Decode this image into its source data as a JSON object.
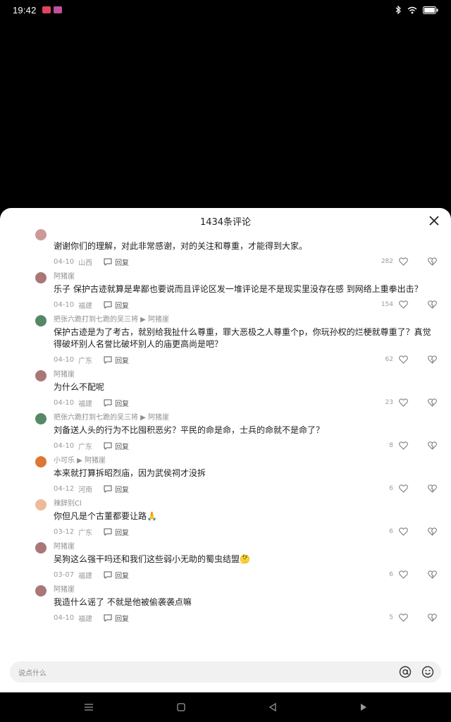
{
  "status": {
    "time": "19:42",
    "notif_colors": [
      "#e0445e",
      "#c0519a"
    ]
  },
  "sheet": {
    "title": "1434条评论"
  },
  "comments": [
    {
      "name": "",
      "text": "谢谢你们的理解，对此非常感谢，对的关注和尊重，才能得到大家。",
      "date": "04-10",
      "region": "山西",
      "reply_label": "回复",
      "likes": "282",
      "avatar": "#c99"
    },
    {
      "name": "阿猪崖",
      "text": "乐子 保护古迹就算是卑鄙也要说而且评论区发一堆评论是不是现实里没存在感 到网络上重拳出击？",
      "date": "04-10",
      "region": "福建",
      "reply_label": "回复",
      "likes": "154",
      "avatar": "#a77"
    },
    {
      "name": "把张六跪打到七跪的吴三将 ▶ 阿猪崖",
      "text": "保护古迹是为了考古，就别给我扯什么尊重，罪大恶极之人尊重个p，你玩孙权的烂梗就尊重了？真觉得破坏别人名誉比破坏别人的庙更高尚是吧？",
      "date": "04-10",
      "region": "广东",
      "reply_label": "回复",
      "likes": "62",
      "avatar": "#586"
    },
    {
      "name": "阿猪崖",
      "text": "为什么不配呢",
      "date": "04-10",
      "region": "福建",
      "reply_label": "回复",
      "likes": "23",
      "avatar": "#a77"
    },
    {
      "name": "把张六跪打到七跪的吴三将 ▶ 阿猪崖",
      "text": "刘备送人头的行为不比囤积恶劣？平民的命是命，士兵的命就不是命了？",
      "date": "04-10",
      "region": "广东",
      "reply_label": "回复",
      "likes": "8",
      "avatar": "#586"
    },
    {
      "name": "小可乐 ▶ 阿猪崖",
      "text": "本来就打算拆昭烈庙，因为武侯祠才没拆",
      "date": "04-12",
      "region": "河南",
      "reply_label": "回复",
      "likes": "6",
      "avatar": "#d73"
    },
    {
      "name": "辣辞别Cl",
      "text": "你但凡是个古董都要让路🙏",
      "date": "03-12",
      "region": "广东",
      "reply_label": "回复",
      "likes": "6",
      "avatar": "#eb9"
    },
    {
      "name": "阿猪崖",
      "text": "吴狗这么强干吗还和我们这些弱小无助的蜀虫结盟🤔",
      "date": "03-07",
      "region": "福建",
      "reply_label": "回复",
      "likes": "6",
      "avatar": "#a77"
    },
    {
      "name": "阿猪崖",
      "text": "我造什么谣了 不就是他被偷袭袭点嘛",
      "date": "04-10",
      "region": "福建",
      "reply_label": "回复",
      "likes": "5",
      "avatar": "#a77"
    }
  ],
  "input": {
    "placeholder": "说点什么"
  },
  "accent": "#1d1d1d"
}
